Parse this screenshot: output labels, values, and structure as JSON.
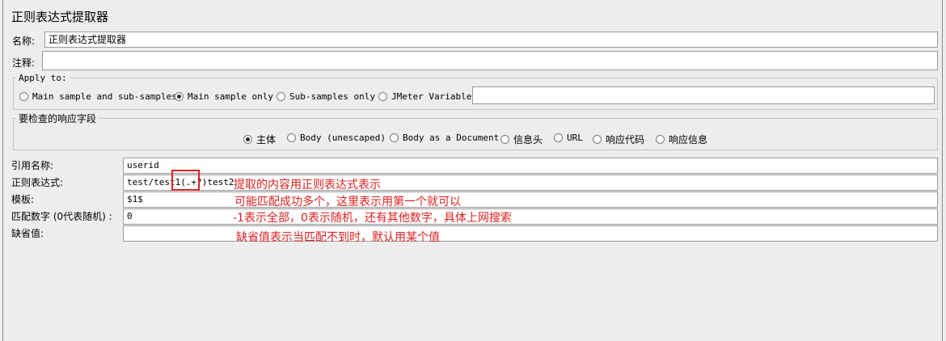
{
  "title": "正则表达式提取器",
  "name_field": {
    "label": "名称:",
    "value": "正则表达式提取器"
  },
  "comment_field": {
    "label": "注释:",
    "value": ""
  },
  "apply_to": {
    "legend": "Apply to:",
    "options": [
      "Main sample and sub-samples",
      "Main sample only",
      "Sub-samples only",
      "JMeter Variable"
    ],
    "selected": "Main sample only",
    "variable_value": ""
  },
  "response_field": {
    "legend": "要检查的响应字段",
    "options": [
      "主体",
      "Body (unescaped)",
      "Body as a Document",
      "信息头",
      "URL",
      "响应代码",
      "响应信息"
    ],
    "selected": "主体"
  },
  "fields": [
    {
      "label": "引用名称:",
      "value": "userid"
    },
    {
      "label": "正则表达式:",
      "value": "test/test1(.+?)test2"
    },
    {
      "label": "模板:",
      "value": "$1$"
    },
    {
      "label": "匹配数字 (0代表随机) :",
      "value": "0"
    },
    {
      "label": "缺省值:",
      "value": ""
    }
  ],
  "annotations": [
    "提取的内容用正则表达式表示",
    "可能匹配成功多个，这里表示用第一个就可以",
    "-1表示全部，0表示随机，还有其他数字，具体上网搜索",
    "缺省值表示当匹配不到时，默认用某个值"
  ],
  "colors": {
    "annotation": "#e02020",
    "background": "#ededed"
  }
}
